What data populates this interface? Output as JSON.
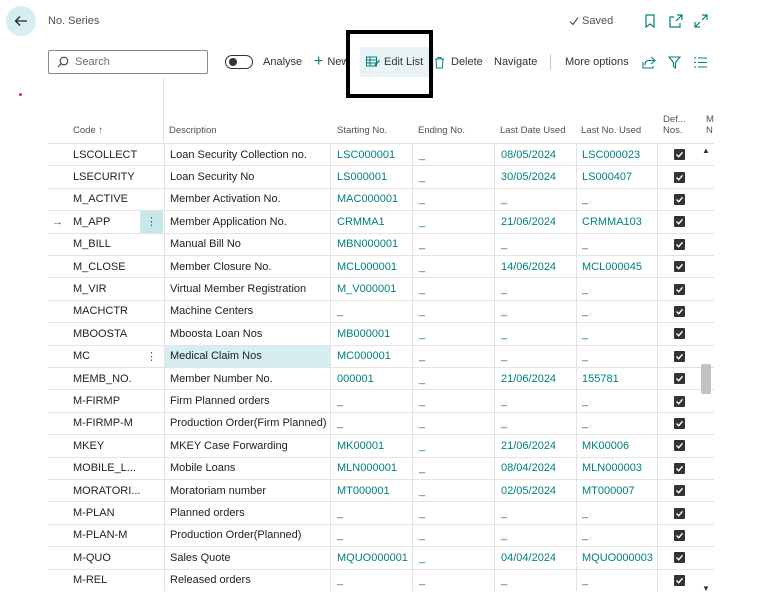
{
  "page": {
    "title": "No. Series",
    "saved_label": "Saved"
  },
  "toolbar": {
    "search_placeholder": "Search",
    "analyse_label": "Analyse",
    "new_label": "New",
    "edit_list_label": "Edit List",
    "delete_label": "Delete",
    "navigate_label": "Navigate",
    "more_options_label": "More options"
  },
  "columns": {
    "code": "Code",
    "description": "Description",
    "starting_no": "Starting No.",
    "ending_no": "Ending No.",
    "last_date_used": "Last Date Used",
    "last_no_used": "Last No. Used",
    "default_nos_line1": "Def...",
    "default_nos_line2": "Nos.",
    "manual_nos_line1": "M",
    "manual_nos_line2": "N"
  },
  "rows": [
    {
      "code": "LSCOLLECT",
      "description": "Loan Security Collection no.",
      "starting_no": "LSC000001",
      "ending_no": "_",
      "last_date_used": "08/05/2024",
      "last_no_used": "LSC000023",
      "default_nos": true
    },
    {
      "code": "LSECURITY",
      "description": "Loan Security No",
      "starting_no": "LS000001",
      "ending_no": "_",
      "last_date_used": "30/05/2024",
      "last_no_used": "LS000407",
      "default_nos": true
    },
    {
      "code": "M_ACTIVE",
      "description": "Member Activation No.",
      "starting_no": "MAC000001",
      "ending_no": "_",
      "last_date_used": "_",
      "last_no_used": "_",
      "default_nos": true
    },
    {
      "code": "M_APP",
      "description": "Member Application No.",
      "starting_no": "CRMMA1",
      "ending_no": "_",
      "last_date_used": "21/06/2024",
      "last_no_used": "CRMMA103",
      "default_nos": true
    },
    {
      "code": "M_BILL",
      "description": "Manual Bill No",
      "starting_no": "MBN000001",
      "ending_no": "_",
      "last_date_used": "_",
      "last_no_used": "_",
      "default_nos": true
    },
    {
      "code": "M_CLOSE",
      "description": "Member Closure No.",
      "starting_no": "MCL000001",
      "ending_no": "_",
      "last_date_used": "14/06/2024",
      "last_no_used": "MCL000045",
      "default_nos": true
    },
    {
      "code": "M_VIR",
      "description": "Virtual Member Registration",
      "starting_no": "M_V000001",
      "ending_no": "_",
      "last_date_used": "_",
      "last_no_used": "_",
      "default_nos": true
    },
    {
      "code": "MACHCTR",
      "description": "Machine Centers",
      "starting_no": "_",
      "ending_no": "_",
      "last_date_used": "_",
      "last_no_used": "_",
      "default_nos": true
    },
    {
      "code": "MBOOSTA",
      "description": "Mboosta Loan Nos",
      "starting_no": "MB000001",
      "ending_no": "_",
      "last_date_used": "_",
      "last_no_used": "_",
      "default_nos": true
    },
    {
      "code": "MC",
      "description": "Medical Claim Nos",
      "starting_no": "MC000001",
      "ending_no": "_",
      "last_date_used": "_",
      "last_no_used": "_",
      "default_nos": true
    },
    {
      "code": "MEMB_NO.",
      "description": "Member Number No.",
      "starting_no": "000001",
      "ending_no": "_",
      "last_date_used": "21/06/2024",
      "last_no_used": "155781",
      "default_nos": true
    },
    {
      "code": "M-FIRMP",
      "description": "Firm Planned orders",
      "starting_no": "_",
      "ending_no": "_",
      "last_date_used": "_",
      "last_no_used": "_",
      "default_nos": true
    },
    {
      "code": "M-FIRMP-M",
      "description": "Production Order(Firm Planned)",
      "starting_no": "_",
      "ending_no": "_",
      "last_date_used": "_",
      "last_no_used": "_",
      "default_nos": true
    },
    {
      "code": "MKEY",
      "description": "MKEY Case Forwarding",
      "starting_no": "MK00001",
      "ending_no": "_",
      "last_date_used": "21/06/2024",
      "last_no_used": "MK00006",
      "default_nos": true
    },
    {
      "code": "MOBILE_L...",
      "description": "Mobile Loans",
      "starting_no": "MLN000001",
      "ending_no": "_",
      "last_date_used": "08/04/2024",
      "last_no_used": "MLN000003",
      "default_nos": true
    },
    {
      "code": "MORATORI...",
      "description": "Moratoriam number",
      "starting_no": "MT000001",
      "ending_no": "_",
      "last_date_used": "02/05/2024",
      "last_no_used": "MT000007",
      "default_nos": true
    },
    {
      "code": "M-PLAN",
      "description": "Planned orders",
      "starting_no": "_",
      "ending_no": "_",
      "last_date_used": "_",
      "last_no_used": "_",
      "default_nos": true
    },
    {
      "code": "M-PLAN-M",
      "description": "Production Order(Planned)",
      "starting_no": "_",
      "ending_no": "_",
      "last_date_used": "_",
      "last_no_used": "_",
      "default_nos": true
    },
    {
      "code": "M-QUO",
      "description": "Sales Quote",
      "starting_no": "MQUO000001",
      "ending_no": "_",
      "last_date_used": "04/04/2024",
      "last_no_used": "MQUO000003",
      "default_nos": true
    },
    {
      "code": "M-REL",
      "description": "Released orders",
      "starting_no": "_",
      "ending_no": "_",
      "last_date_used": "_",
      "last_no_used": "_",
      "default_nos": true
    }
  ],
  "colors": {
    "accent": "#00807d",
    "selected_row": "#d6eef1"
  }
}
